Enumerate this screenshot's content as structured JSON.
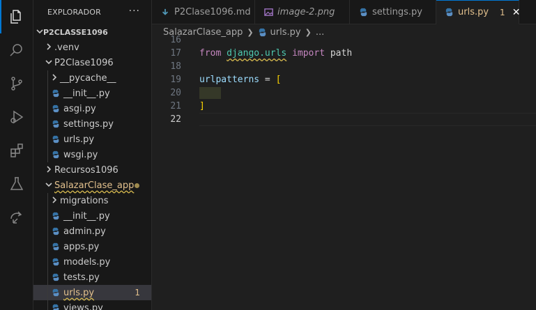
{
  "explorer": {
    "title": "EXPLORADOR",
    "more": "···",
    "root": "P2CLASSE1096",
    "items": [
      {
        "label": ".venv",
        "kind": "folder",
        "open": false
      },
      {
        "label": "P2Clase1096",
        "kind": "folder",
        "open": true
      },
      {
        "label": "__pycache__",
        "kind": "folder",
        "open": false
      },
      {
        "label": "__init__.py",
        "kind": "file"
      },
      {
        "label": "asgi.py",
        "kind": "file"
      },
      {
        "label": "settings.py",
        "kind": "file"
      },
      {
        "label": "urls.py",
        "kind": "file"
      },
      {
        "label": "wsgi.py",
        "kind": "file"
      },
      {
        "label": "Recursos1096",
        "kind": "folder",
        "open": false
      },
      {
        "label": "SalazarClase_app",
        "kind": "folder",
        "open": true
      },
      {
        "label": "migrations",
        "kind": "folder",
        "open": false
      },
      {
        "label": "__init__.py",
        "kind": "file"
      },
      {
        "label": "admin.py",
        "kind": "file"
      },
      {
        "label": "apps.py",
        "kind": "file"
      },
      {
        "label": "models.py",
        "kind": "file"
      },
      {
        "label": "tests.py",
        "kind": "file"
      },
      {
        "label": "urls.py",
        "kind": "file",
        "badge": "1"
      },
      {
        "label": "views.py",
        "kind": "file"
      }
    ]
  },
  "tabs": [
    {
      "label": "P2Clase1096.md",
      "icon": "markdown-icon"
    },
    {
      "label": "image-2.png",
      "icon": "image-icon"
    },
    {
      "label": "settings.py",
      "icon": "python-icon"
    },
    {
      "label": "urls.py",
      "icon": "python-icon",
      "badge": "1",
      "close": "✕"
    }
  ],
  "breadcrumb": {
    "folder": "SalazarClase_app",
    "file": "urls.py",
    "ellipsis": "..."
  },
  "editor": {
    "lines": [
      {
        "n": "16"
      },
      {
        "n": "17",
        "kw1": "from",
        "module": "django.urls",
        "kw2": "import",
        "name": "path"
      },
      {
        "n": "18"
      },
      {
        "n": "19",
        "var": "urlpatterns",
        "op": " = ",
        "open": "["
      },
      {
        "n": "20"
      },
      {
        "n": "21",
        "close": "]"
      },
      {
        "n": "22"
      }
    ]
  },
  "colors": {
    "accent": "#0078d4",
    "modified": "#e2c08d",
    "python": "#3572a5"
  }
}
